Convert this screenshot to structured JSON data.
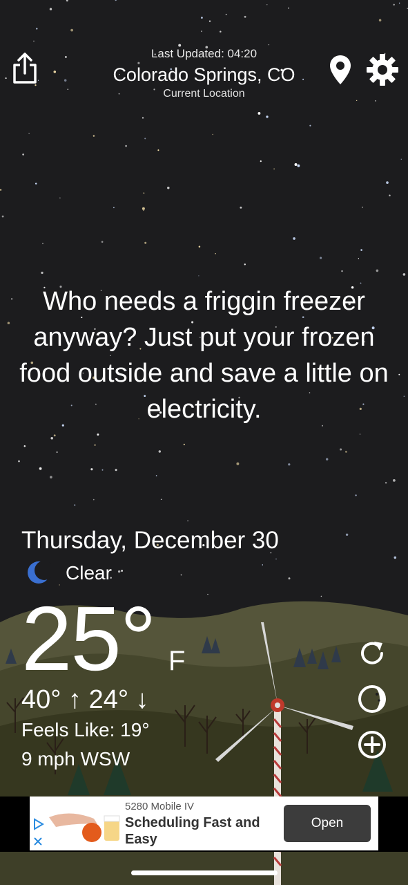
{
  "header": {
    "last_updated": "Last Updated: 04:20",
    "city": "Colorado Springs, CO",
    "current_location": "Current Location"
  },
  "joke": "Who needs a friggin freezer anyway? Just put your frozen food outside and save a little on electricity.",
  "weather": {
    "date": "Thursday, December 30",
    "condition": "Clear",
    "condition_icon": "moon-icon",
    "temperature": "25°",
    "unit": "F",
    "high_low": "40° ↑  24° ↓",
    "feels_like": "Feels Like: 19°",
    "wind": "9 mph WSW"
  },
  "ad": {
    "company": "5280 Mobile IV",
    "title": "Scheduling Fast and Easy",
    "button_label": "Open"
  },
  "colors": {
    "sky": "#1c1c1e",
    "hills_far": "#5a5a3a",
    "hills_near": "#3e3f28",
    "moon": "#3a6fd0",
    "ad_button": "#3c3c3c"
  }
}
